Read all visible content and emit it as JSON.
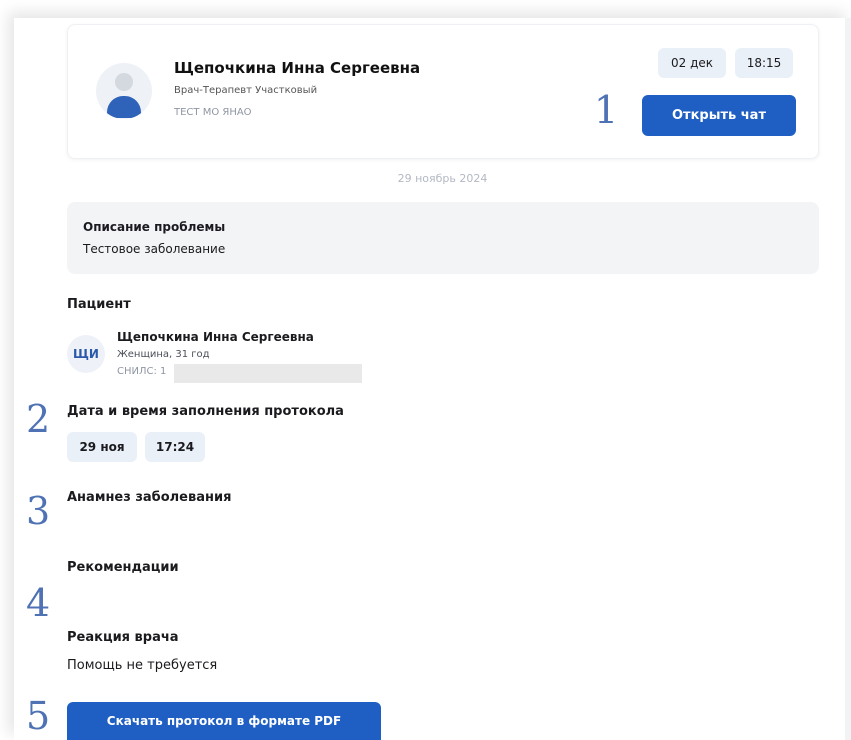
{
  "doctor": {
    "name": "Щепочкина Инна Сергеевна",
    "role": "Врач-Терапевт Участковый",
    "org": "ТЕСТ МО ЯНАО",
    "date": "02 дек",
    "time": "18:15",
    "chat_button": "Открыть чат"
  },
  "date_separator": "29 ноябрь 2024",
  "problem": {
    "title": "Описание проблемы",
    "text": "Тестовое заболевание"
  },
  "patient": {
    "section_title": "Пациент",
    "initials": "ЩИ",
    "name": "Щепочкина Инна Сергеевна",
    "info": "Женщина, 31 год",
    "snils_label": "СНИЛС: 1"
  },
  "protocol": {
    "section_title": "Дата и время заполнения протокола",
    "date": "29 ноя",
    "time": "17:24"
  },
  "anamnesis": {
    "section_title": "Анамнез заболевания"
  },
  "recommendations": {
    "section_title": "Рекомендации"
  },
  "reaction": {
    "section_title": "Реакция врача",
    "text": "Помощь не требуется"
  },
  "pdf_button": "Скачать протокол в формате PDF",
  "annotations": [
    "1",
    "2",
    "3",
    "4",
    "5"
  ],
  "colors": {
    "accent": "#1f5fc4",
    "chip_bg": "#eaf0f8",
    "panel_bg": "#f3f4f6",
    "annotation": "#4f72b5"
  }
}
